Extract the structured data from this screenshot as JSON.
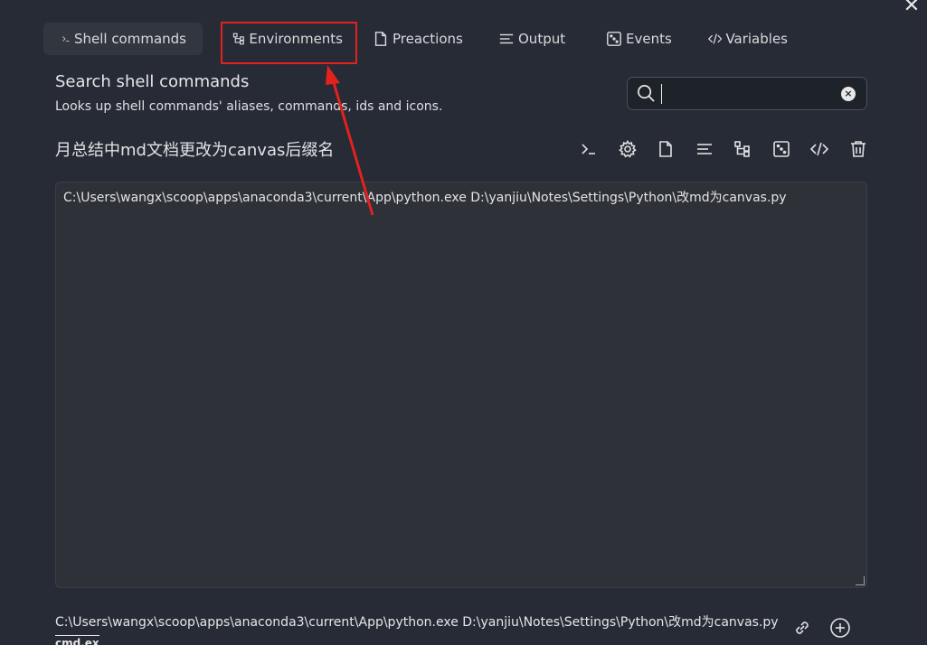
{
  "window": {
    "close_label": "✕"
  },
  "tabs": [
    {
      "label": "Shell commands",
      "icon": "terminal-icon",
      "active": true
    },
    {
      "label": "Environments",
      "icon": "git-branch-icon",
      "active": false
    },
    {
      "label": "Preactions",
      "icon": "file-icon",
      "active": false
    },
    {
      "label": "Output",
      "icon": "align-left-icon",
      "active": false
    },
    {
      "label": "Events",
      "icon": "dice-icon",
      "active": false
    },
    {
      "label": "Variables",
      "icon": "code-icon",
      "active": false
    }
  ],
  "search": {
    "title": "Search shell commands",
    "description": "Looks up shell commands' aliases, commands, ids and icons.",
    "value": "",
    "clear_label": "×"
  },
  "command": {
    "name": "月总结中md文档更改为canvas后缀名",
    "toolbar_icons": [
      "terminal-icon",
      "gear-icon",
      "file-icon",
      "align-left-icon",
      "git-branch-icon",
      "dice-icon",
      "code-icon",
      "trash-icon"
    ],
    "text": "C:\\Users\\wangx\\scoop\\apps\\anaconda3\\current\\App\\python.exe D:\\yanjiu\\Notes\\Settings\\Python\\改md为canvas.py"
  },
  "footer": {
    "preview": "C:\\Users\\wangx\\scoop\\apps\\anaconda3\\current\\App\\python.exe D:\\yanjiu\\Notes\\Settings\\Python\\改md为canvas.py",
    "shell": "cmd.exe"
  },
  "colors": {
    "background": "#262b36",
    "annotation_red": "#e3221e"
  }
}
